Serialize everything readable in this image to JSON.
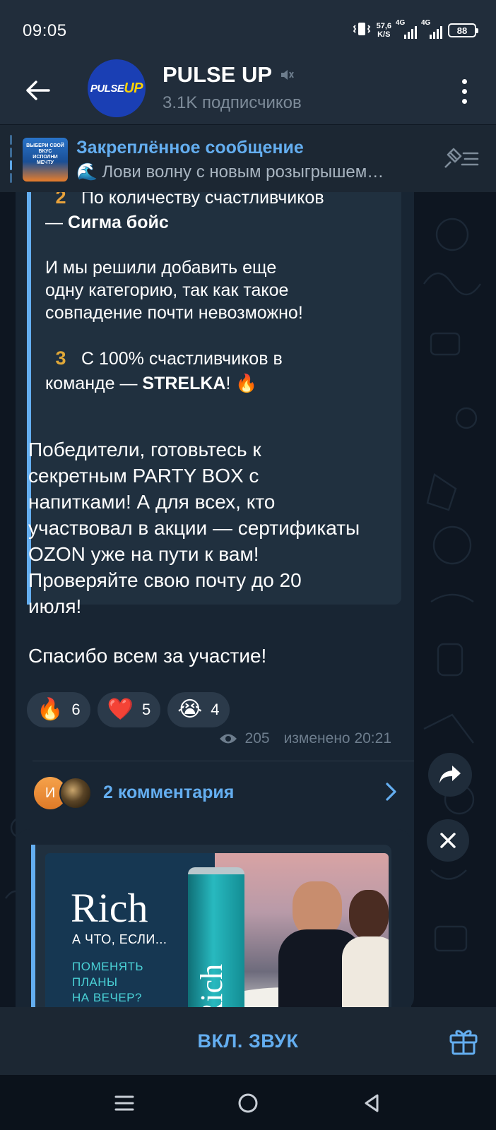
{
  "status_bar": {
    "time": "09:05",
    "net_speed_value": "57,6",
    "net_speed_unit": "K/S",
    "sig1_label": "4G",
    "sig2_label": "4G",
    "battery": "88"
  },
  "header": {
    "logo_text_a": "PULSE",
    "logo_text_b": "UP",
    "title": "PULSE UP",
    "subscribers": "3.1K подписчиков"
  },
  "pinned": {
    "title": "Закреплённое сообщение",
    "text": "🌊 Лови волну с новым розыгрышем…",
    "thumb_text": "ВЫБЕРИ СВОЙ ВКУС ИСПОЛНИ МЕЧТУ"
  },
  "message": {
    "quote": {
      "line1_num": "2",
      "line1_text": "По количеству счастливчиков",
      "line2_prefix": "— ",
      "line2_bold": "Сигма бойс",
      "line3": "И мы решили добавить еще",
      "line4": "одну категорию, так как такое",
      "line5": "совпадение почти невозможно!",
      "line6_num": "3",
      "line6_text": "С 100% счастливчиков в",
      "line7_prefix": "команде — ",
      "line7_bold": "STRELKA",
      "line7_suffix": "! 🔥"
    },
    "body_lines": [
      "Победители, готовьтесь к",
      "секретным PARTY BOX с",
      "напитками! А для всех, кто",
      "участвовал в акции — сертификаты",
      "OZON уже на пути к вам!",
      "Проверяйте свою почту до 20",
      "июля!"
    ],
    "thanks": "Спасибо всем за участие!",
    "reactions": [
      {
        "emoji": "🔥",
        "count": "6"
      },
      {
        "emoji": "❤️",
        "count": "5"
      },
      {
        "emoji": "😭",
        "count": "4"
      }
    ],
    "views": "205",
    "edited": "изменено 20:21",
    "comments_avatar_initial": "И",
    "comments_label": "2 комментария"
  },
  "ad": {
    "brand": "Rich",
    "tagline": "А ЧТО, ЕСЛИ...",
    "subline": "ПОМЕНЯТЬ\nПЛАНЫ\nНА ВЕЧЕР?",
    "can_text": "Rich"
  },
  "bottom": {
    "unmute_label": "ВКЛ. ЗВУК"
  },
  "colors": {
    "accent": "#64aef0",
    "bubble": "#182533",
    "background": "#0e1621",
    "header": "#212d3b"
  }
}
